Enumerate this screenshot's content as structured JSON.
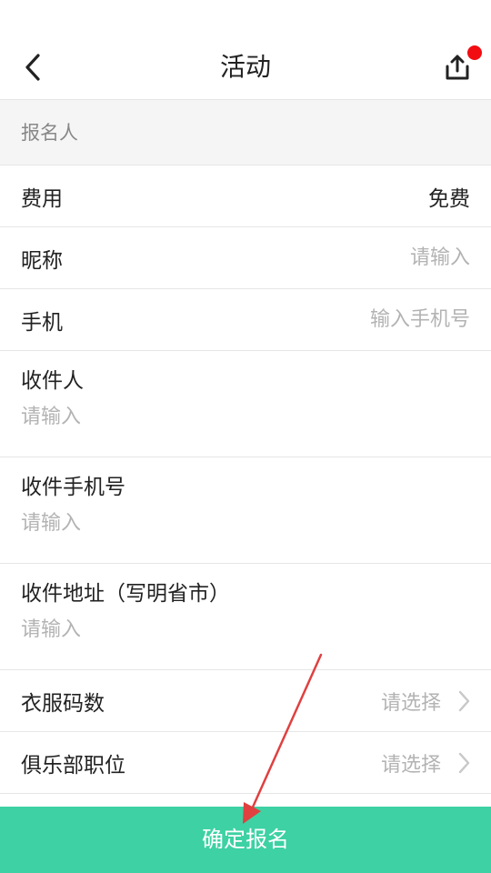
{
  "header": {
    "title": "活动",
    "back_icon": "chevron-left-icon",
    "share_icon": "share-upload-icon",
    "notification_dot_color": "#f20d12"
  },
  "section": {
    "title": "报名人"
  },
  "form": {
    "fee": {
      "label": "费用",
      "value": "免费"
    },
    "nickname": {
      "label": "昵称",
      "placeholder": "请输入"
    },
    "phone": {
      "label": "手机",
      "placeholder": "输入手机号"
    },
    "recipient": {
      "label": "收件人",
      "placeholder": "请输入"
    },
    "recipient_phone": {
      "label": "收件手机号",
      "placeholder": "请输入"
    },
    "address": {
      "label": "收件地址（写明省市）",
      "placeholder": "请输入"
    },
    "clothing_size": {
      "label": "衣服码数",
      "placeholder": "请选择"
    },
    "club_position": {
      "label": "俱乐部职位",
      "placeholder": "请选择"
    }
  },
  "submit": {
    "label": "确定报名",
    "color": "#3dd1a3"
  },
  "annotation": {
    "arrow_color": "#e04040"
  }
}
